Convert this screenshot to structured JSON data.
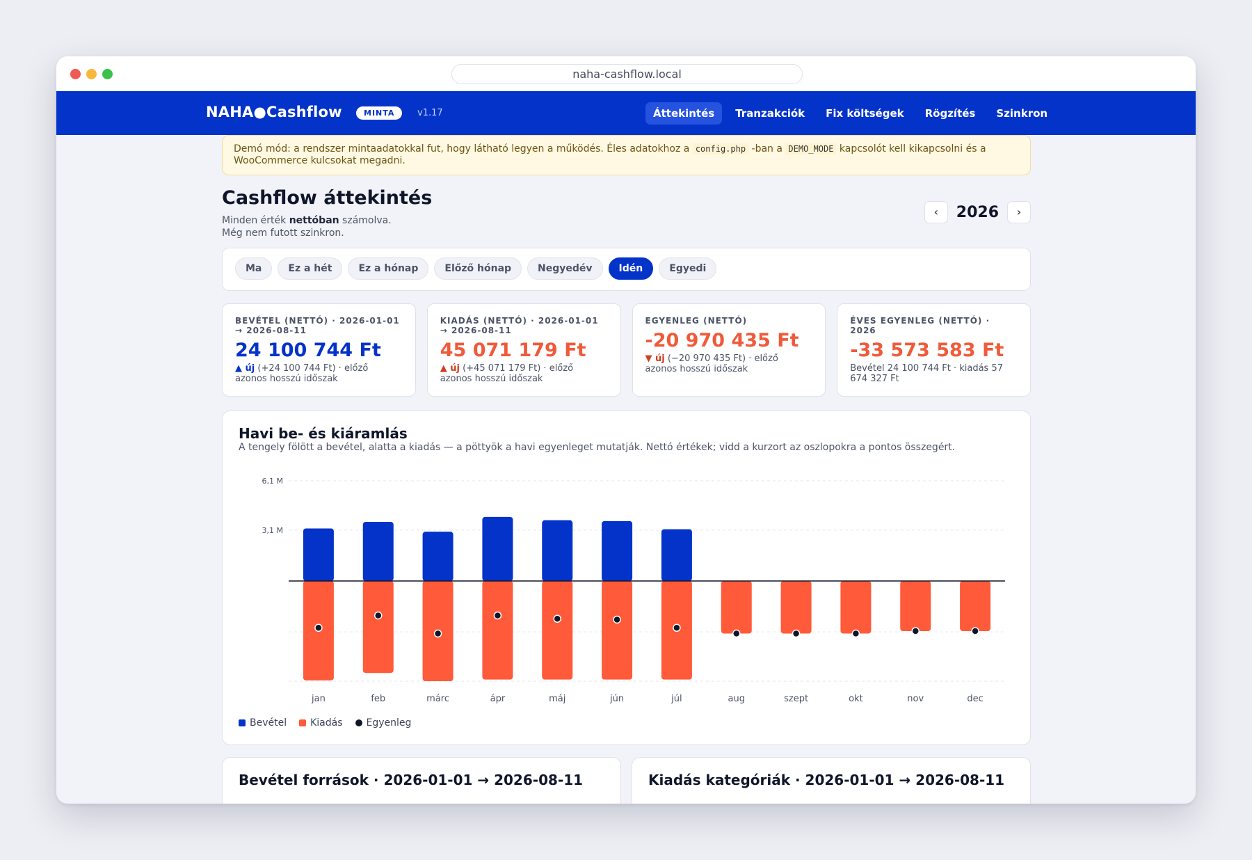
{
  "browser": {
    "url": "naha-cashflow.local"
  },
  "navbar": {
    "brand": "NAHA●Cashflow",
    "badge": "MINTA",
    "version": "v1.17",
    "items": [
      {
        "label": "Áttekintés",
        "active": true
      },
      {
        "label": "Tranzakciók",
        "active": false
      },
      {
        "label": "Fix költségek",
        "active": false
      },
      {
        "label": "Rögzítés",
        "active": false
      },
      {
        "label": "Szinkron",
        "active": false
      }
    ]
  },
  "demo_notice": {
    "part1": "Demó mód: a rendszer mintaadatokkal fut, hogy látható legyen a működés. Éles adatokhoz a ",
    "code1": "config.php",
    "part2": " -ban a ",
    "code2": "DEMO_MODE",
    "part3": " kapcsolót kell kikapcsolni és a WooCommerce kulcsokat megadni."
  },
  "header": {
    "title": "Cashflow áttekintés",
    "subtitle_pre": "Minden érték ",
    "subtitle_bold": "nettóban",
    "subtitle_post": " számolva.",
    "sync_status": "Még nem futott szinkron.",
    "year": "2026",
    "prev_symbol": "‹",
    "next_symbol": "›"
  },
  "filters": [
    {
      "label": "Ma",
      "active": false
    },
    {
      "label": "Ez a hét",
      "active": false
    },
    {
      "label": "Ez a hónap",
      "active": false
    },
    {
      "label": "Előző hónap",
      "active": false
    },
    {
      "label": "Negyedév",
      "active": false
    },
    {
      "label": "Idén",
      "active": true
    },
    {
      "label": "Egyedi",
      "active": false
    }
  ],
  "kpis": [
    {
      "label": "BEVÉTEL (NETTÓ) · 2026-01-01 → 2026-08-11",
      "value": "24 100 744 Ft",
      "tone": "pos",
      "arrow": "▲ új",
      "arrow_tone": "up",
      "note": " (+24 100 744 Ft) · előző azonos hosszú időszak"
    },
    {
      "label": "KIADÁS (NETTÓ) · 2026-01-01 → 2026-08-11",
      "value": "45 071 179 Ft",
      "tone": "neg",
      "arrow": "▲ új",
      "arrow_tone": "red",
      "note": " (+45 071 179 Ft) · előző azonos hosszú időszak"
    },
    {
      "label": "EGYENLEG (NETTÓ)",
      "value": "-20 970 435 Ft",
      "tone": "neg",
      "arrow": "▼ új",
      "arrow_tone": "red",
      "note": " (−20 970 435 Ft) · előző azonos hosszú időszak"
    },
    {
      "label": "ÉVES EGYENLEG (NETTÓ) · 2026",
      "value": "-33 573 583 Ft",
      "tone": "neg",
      "arrow": "",
      "arrow_tone": "",
      "note": "Bevétel 24 100 744 Ft · kiadás 57 674 327 Ft"
    }
  ],
  "chart": {
    "title": "Havi be- és kiáramlás",
    "subtitle": "A tengely fölött a bevétel, alatta a kiadás — a pöttyök a havi egyenleget mutatják. Nettó értékek; vidd a kurzort az oszlopokra a pontos összegért.",
    "legend": [
      {
        "label": "Bevétel",
        "color": "#0433c9",
        "shape": "square"
      },
      {
        "label": "Kiadás",
        "color": "#ff5a3a",
        "shape": "square"
      },
      {
        "label": "Egyenleg",
        "color": "#10162a",
        "shape": "circle"
      }
    ]
  },
  "chart_data": {
    "type": "bar",
    "categories": [
      "jan",
      "feb",
      "márc",
      "ápr",
      "máj",
      "jún",
      "júl",
      "aug",
      "szept",
      "okt",
      "nov",
      "dec"
    ],
    "series": [
      {
        "name": "Bevétel",
        "color": "#0433c9",
        "values": [
          3.2,
          3.6,
          3.0,
          3.9,
          3.7,
          3.65,
          3.15,
          0,
          0,
          0,
          0,
          0
        ]
      },
      {
        "name": "Kiadás",
        "color": "#ff5a3a",
        "values": [
          -6.05,
          -5.6,
          -6.1,
          -6.0,
          -6.0,
          -6.0,
          -6.0,
          -3.2,
          -3.2,
          -3.2,
          -3.05,
          -3.05
        ]
      },
      {
        "name": "Egyenleg",
        "color": "#10162a",
        "values": [
          -2.85,
          -2.1,
          -3.2,
          -2.1,
          -2.3,
          -2.35,
          -2.85,
          -3.2,
          -3.2,
          -3.2,
          -3.05,
          -3.05
        ]
      }
    ],
    "yticks": [
      {
        "value": 6.1,
        "label": "6,1 M"
      },
      {
        "value": 3.1,
        "label": "3,1 M"
      }
    ],
    "ylim": [
      -6.1,
      6.1
    ],
    "grid": true
  },
  "bottom_cards": [
    {
      "title": "Bevétel források · 2026-01-01 → 2026-08-11"
    },
    {
      "title": "Kiadás kategóriák · 2026-01-01 → 2026-08-11"
    }
  ]
}
